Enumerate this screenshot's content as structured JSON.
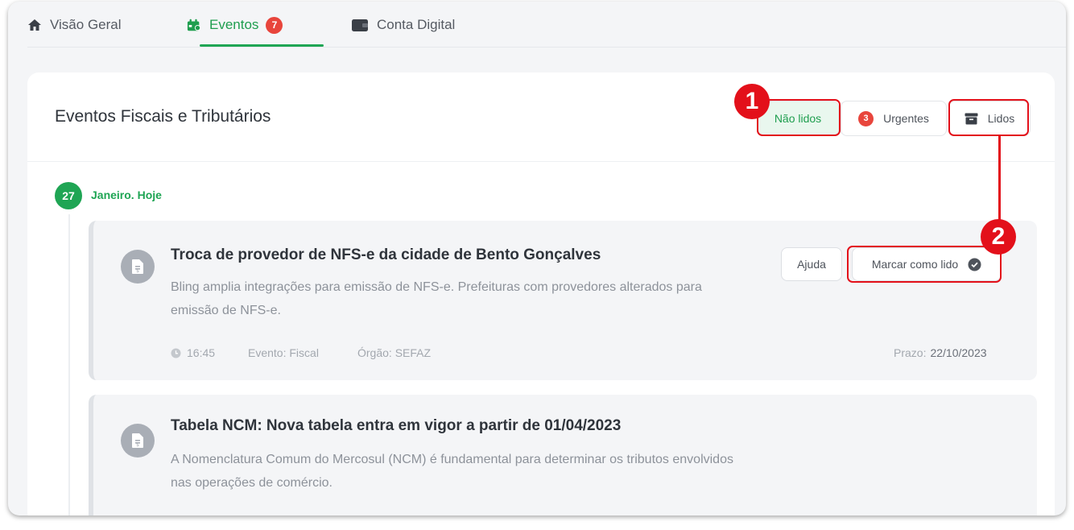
{
  "tabs": [
    {
      "label": "Visão Geral",
      "icon": "home-icon"
    },
    {
      "label": "Eventos",
      "icon": "calendar-icon",
      "badge": "7"
    },
    {
      "label": "Conta Digital",
      "icon": "wallet-icon"
    }
  ],
  "card": {
    "title": "Eventos Fiscais e Tributários",
    "filters": {
      "unread": "Não lidos",
      "urgent_count": "3",
      "urgent": "Urgentes",
      "read": "Lidos"
    }
  },
  "markers": {
    "one": "1",
    "two": "2"
  },
  "date_group": {
    "day": "27",
    "label": "Janeiro. Hoje"
  },
  "events": [
    {
      "title": "Troca de provedor de NFS-e da cidade de Bento Gonçalves",
      "description": "Bling amplia integrações para emissão de NFS-e. Prefeituras com provedores alterados para emissão de NFS-e.",
      "time": "16:45",
      "event_type": "Evento: Fiscal",
      "organ": "Órgão: SEFAZ",
      "deadline_label": "Prazo:",
      "deadline_value": "22/10/2023",
      "help_label": "Ajuda",
      "mark_read_label": "Marcar como lido"
    },
    {
      "title": "Tabela NCM: Nova tabela entra em vigor a partir de 01/04/2023",
      "description": "A Nomenclatura Comum do Mercosul (NCM) é fundamental para determinar os tributos envolvidos nas operações de comércio."
    }
  ],
  "colors": {
    "accent": "#1fa554",
    "highlight": "#e3101a",
    "badge": "#e8453c"
  }
}
